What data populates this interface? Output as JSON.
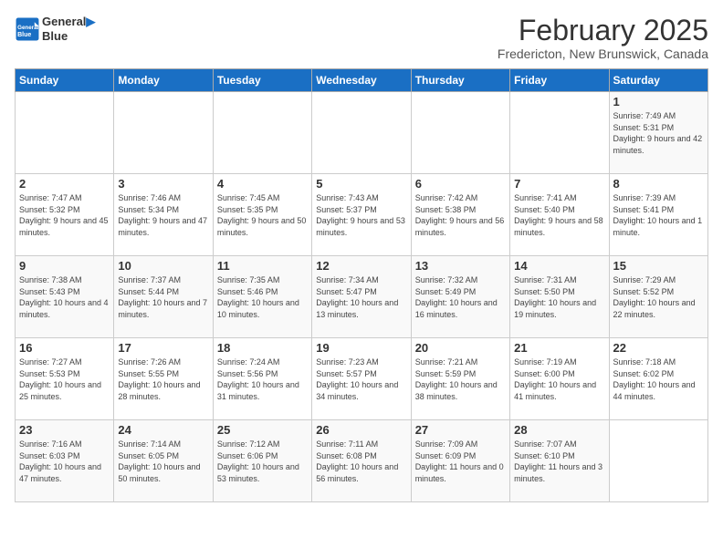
{
  "header": {
    "logo_line1": "General",
    "logo_line2": "Blue",
    "title": "February 2025",
    "subtitle": "Fredericton, New Brunswick, Canada"
  },
  "days_of_week": [
    "Sunday",
    "Monday",
    "Tuesday",
    "Wednesday",
    "Thursday",
    "Friday",
    "Saturday"
  ],
  "weeks": [
    [
      {
        "day": "",
        "info": ""
      },
      {
        "day": "",
        "info": ""
      },
      {
        "day": "",
        "info": ""
      },
      {
        "day": "",
        "info": ""
      },
      {
        "day": "",
        "info": ""
      },
      {
        "day": "",
        "info": ""
      },
      {
        "day": "1",
        "info": "Sunrise: 7:49 AM\nSunset: 5:31 PM\nDaylight: 9 hours and 42 minutes."
      }
    ],
    [
      {
        "day": "2",
        "info": "Sunrise: 7:47 AM\nSunset: 5:32 PM\nDaylight: 9 hours and 45 minutes."
      },
      {
        "day": "3",
        "info": "Sunrise: 7:46 AM\nSunset: 5:34 PM\nDaylight: 9 hours and 47 minutes."
      },
      {
        "day": "4",
        "info": "Sunrise: 7:45 AM\nSunset: 5:35 PM\nDaylight: 9 hours and 50 minutes."
      },
      {
        "day": "5",
        "info": "Sunrise: 7:43 AM\nSunset: 5:37 PM\nDaylight: 9 hours and 53 minutes."
      },
      {
        "day": "6",
        "info": "Sunrise: 7:42 AM\nSunset: 5:38 PM\nDaylight: 9 hours and 56 minutes."
      },
      {
        "day": "7",
        "info": "Sunrise: 7:41 AM\nSunset: 5:40 PM\nDaylight: 9 hours and 58 minutes."
      },
      {
        "day": "8",
        "info": "Sunrise: 7:39 AM\nSunset: 5:41 PM\nDaylight: 10 hours and 1 minute."
      }
    ],
    [
      {
        "day": "9",
        "info": "Sunrise: 7:38 AM\nSunset: 5:43 PM\nDaylight: 10 hours and 4 minutes."
      },
      {
        "day": "10",
        "info": "Sunrise: 7:37 AM\nSunset: 5:44 PM\nDaylight: 10 hours and 7 minutes."
      },
      {
        "day": "11",
        "info": "Sunrise: 7:35 AM\nSunset: 5:46 PM\nDaylight: 10 hours and 10 minutes."
      },
      {
        "day": "12",
        "info": "Sunrise: 7:34 AM\nSunset: 5:47 PM\nDaylight: 10 hours and 13 minutes."
      },
      {
        "day": "13",
        "info": "Sunrise: 7:32 AM\nSunset: 5:49 PM\nDaylight: 10 hours and 16 minutes."
      },
      {
        "day": "14",
        "info": "Sunrise: 7:31 AM\nSunset: 5:50 PM\nDaylight: 10 hours and 19 minutes."
      },
      {
        "day": "15",
        "info": "Sunrise: 7:29 AM\nSunset: 5:52 PM\nDaylight: 10 hours and 22 minutes."
      }
    ],
    [
      {
        "day": "16",
        "info": "Sunrise: 7:27 AM\nSunset: 5:53 PM\nDaylight: 10 hours and 25 minutes."
      },
      {
        "day": "17",
        "info": "Sunrise: 7:26 AM\nSunset: 5:55 PM\nDaylight: 10 hours and 28 minutes."
      },
      {
        "day": "18",
        "info": "Sunrise: 7:24 AM\nSunset: 5:56 PM\nDaylight: 10 hours and 31 minutes."
      },
      {
        "day": "19",
        "info": "Sunrise: 7:23 AM\nSunset: 5:57 PM\nDaylight: 10 hours and 34 minutes."
      },
      {
        "day": "20",
        "info": "Sunrise: 7:21 AM\nSunset: 5:59 PM\nDaylight: 10 hours and 38 minutes."
      },
      {
        "day": "21",
        "info": "Sunrise: 7:19 AM\nSunset: 6:00 PM\nDaylight: 10 hours and 41 minutes."
      },
      {
        "day": "22",
        "info": "Sunrise: 7:18 AM\nSunset: 6:02 PM\nDaylight: 10 hours and 44 minutes."
      }
    ],
    [
      {
        "day": "23",
        "info": "Sunrise: 7:16 AM\nSunset: 6:03 PM\nDaylight: 10 hours and 47 minutes."
      },
      {
        "day": "24",
        "info": "Sunrise: 7:14 AM\nSunset: 6:05 PM\nDaylight: 10 hours and 50 minutes."
      },
      {
        "day": "25",
        "info": "Sunrise: 7:12 AM\nSunset: 6:06 PM\nDaylight: 10 hours and 53 minutes."
      },
      {
        "day": "26",
        "info": "Sunrise: 7:11 AM\nSunset: 6:08 PM\nDaylight: 10 hours and 56 minutes."
      },
      {
        "day": "27",
        "info": "Sunrise: 7:09 AM\nSunset: 6:09 PM\nDaylight: 11 hours and 0 minutes."
      },
      {
        "day": "28",
        "info": "Sunrise: 7:07 AM\nSunset: 6:10 PM\nDaylight: 11 hours and 3 minutes."
      },
      {
        "day": "",
        "info": ""
      }
    ]
  ]
}
